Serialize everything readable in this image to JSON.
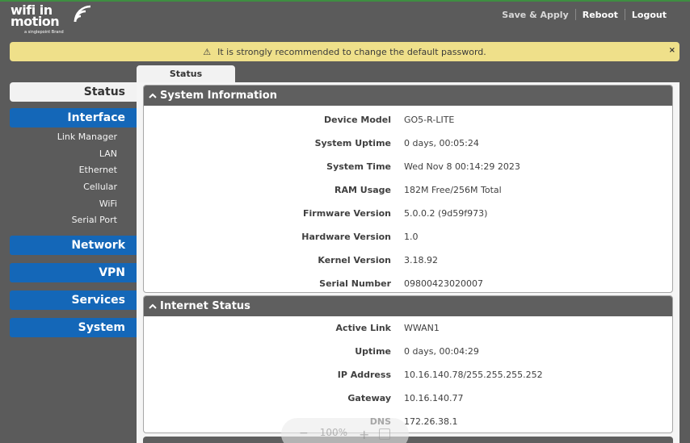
{
  "header": {
    "logo": {
      "line1": "wifi in",
      "line2": "motion",
      "tagline": "a singlepoint Brand"
    },
    "links": [
      "Save & Apply",
      "Reboot",
      "Logout"
    ]
  },
  "alert": {
    "message": "It is strongly recommended to change the default password.",
    "close": "×",
    "icon": "warning-icon"
  },
  "tab": {
    "label": "Status"
  },
  "sidebar": {
    "status": "Status",
    "interface": "Interface",
    "sub_items": [
      "Link Manager",
      "LAN",
      "Ethernet",
      "Cellular",
      "WiFi",
      "Serial Port"
    ],
    "sections": [
      "Network",
      "VPN",
      "Services",
      "System"
    ]
  },
  "system_info": {
    "title": "System Information",
    "rows": [
      {
        "label": "Device Model",
        "value": "GO5-R-LITE"
      },
      {
        "label": "System Uptime",
        "value": "0 days, 00:05:24"
      },
      {
        "label": "System Time",
        "value": "Wed Nov 8 00:14:29 2023"
      },
      {
        "label": "RAM Usage",
        "value": "182M Free/256M Total"
      },
      {
        "label": "Firmware Version",
        "value": "5.0.0.2 (9d59f973)"
      },
      {
        "label": "Hardware Version",
        "value": "1.0"
      },
      {
        "label": "Kernel Version",
        "value": "3.18.92"
      },
      {
        "label": "Serial Number",
        "value": "09800423020007"
      }
    ]
  },
  "internet_status": {
    "title": "Internet Status",
    "rows": [
      {
        "label": "Active Link",
        "value": "WWAN1"
      },
      {
        "label": "Uptime",
        "value": "0 days, 00:04:29"
      },
      {
        "label": "IP Address",
        "value": "10.16.140.78/255.255.255.252"
      },
      {
        "label": "Gateway",
        "value": "10.16.140.77"
      },
      {
        "label": "DNS",
        "value": "172.26.38.1"
      }
    ]
  },
  "zoom": {
    "minus": "−",
    "level": "100%",
    "plus": "+"
  },
  "colors": {
    "accent": "#1467b8",
    "background": "#5b5b5b",
    "alert": "#efe08a"
  }
}
